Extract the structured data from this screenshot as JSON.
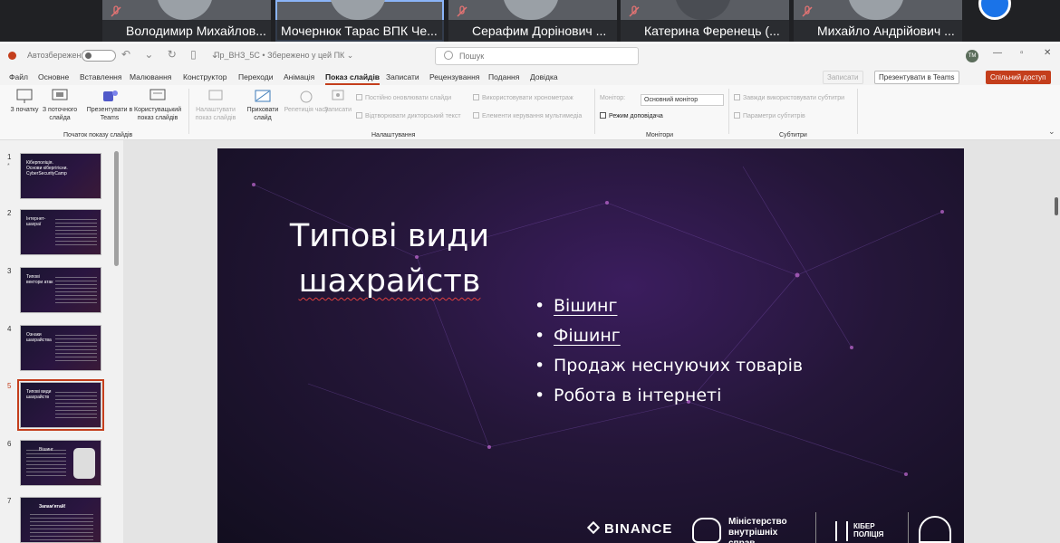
{
  "meeting": {
    "participants": [
      {
        "name": "Володимир Михайлов..."
      },
      {
        "name": "Мочернюк Тарас ВПК Че..."
      },
      {
        "name": "Серафим Дорінович ..."
      },
      {
        "name": "Катерина  Ференець (..."
      },
      {
        "name": "Михайло Андрійович ..."
      }
    ]
  },
  "titlebar": {
    "autosave": "Автозбереження",
    "doc": "Пр_ВНЗ_5С • Збережено у цей ПК ⌄",
    "search_placeholder": "Пошук",
    "avatar": "ТМ"
  },
  "menu": {
    "tabs": [
      "Файл",
      "Основне",
      "Вставлення",
      "Малювання",
      "Конструктор",
      "Переходи",
      "Анімація",
      "Показ слайдів",
      "Записати",
      "Рецензування",
      "Подання",
      "Довідка"
    ],
    "record_btn": "Записати",
    "teams_btn": "Презентувати в Teams",
    "share_btn": "Спільний доступ"
  },
  "ribbon": {
    "start": [
      "З початку",
      "З поточного слайда",
      "Презентувати в Teams",
      "Користувацький показ слайдів"
    ],
    "start_group": "Початок показу слайдів",
    "setup": [
      "Налаштувати показ слайдів",
      "Приховати слайд",
      "Репетиція часу",
      "Записати"
    ],
    "setup_opts": [
      "Постійно оновлювати слайди",
      "Відтворювати дикторський текст",
      "Використовувати хронометраж",
      "Елементи керування мультимедіа"
    ],
    "setup_group": "Налаштування",
    "monitor_label": "Монітор:",
    "monitor_value": "Основний монітор",
    "presenter": "Режим доповідача",
    "monitor_group": "Монітори",
    "sub_opts": [
      "Завжди використовувати субтитри",
      "Параметри субтитрів"
    ],
    "sub_group": "Субтитри"
  },
  "thumbs": [
    {
      "num": "1",
      "title": "Кіберполіція. Основи кібергігієни. CyberSecurityCamp"
    },
    {
      "num": "2",
      "title": "Інтернет-шахраї"
    },
    {
      "num": "3",
      "title": "Типові вектори атак"
    },
    {
      "num": "4",
      "title": "Ознаки шахрайства"
    },
    {
      "num": "5",
      "title": "Типові види шахрайств"
    },
    {
      "num": "6",
      "title": "Вішинг"
    },
    {
      "num": "7",
      "title": "Запам'ятай!"
    }
  ],
  "slide": {
    "title_line1": "Типові види",
    "title_line2": "шахрайств",
    "bullets": [
      "Вішинг",
      "Фішинг",
      "Продаж неснуючих товарів",
      "Робота в інтернеті"
    ],
    "logos": {
      "binance": "BINANCE",
      "mvs": "Міністерство внутрішніх справ",
      "cyber1": "КІБЕР",
      "cyber2": "ПОЛІЦІЯ"
    }
  }
}
